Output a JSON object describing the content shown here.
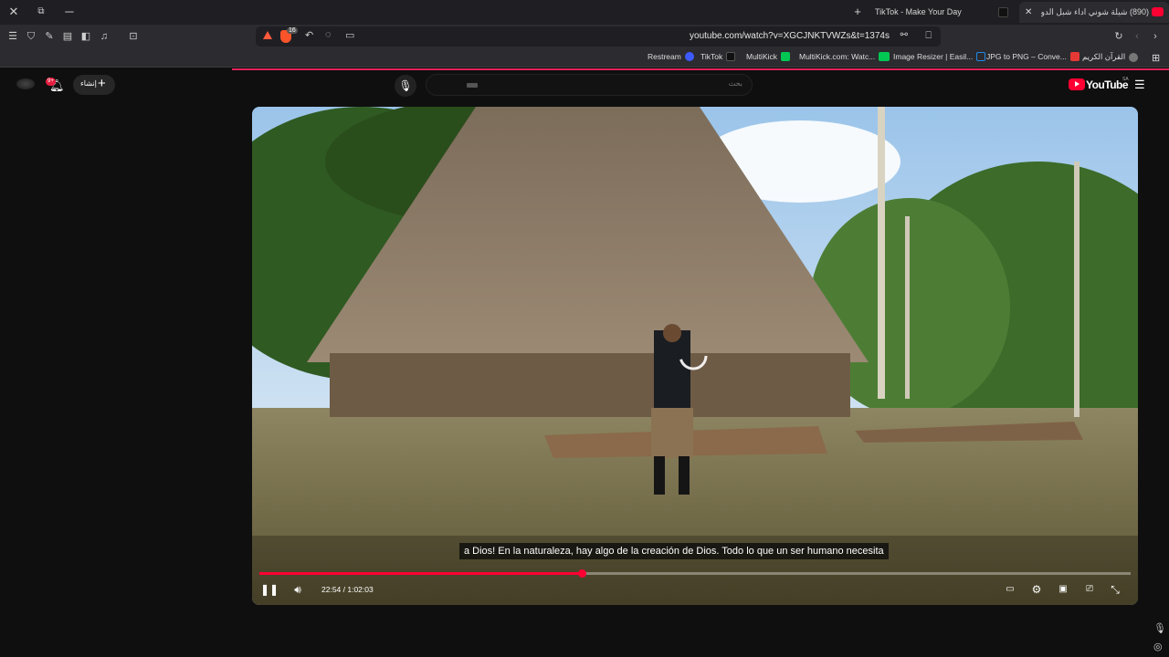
{
  "window": {
    "close": "✕",
    "restore": "⧉",
    "minimize": "─"
  },
  "tabs": [
    {
      "label": "TikTok - Make Your Day",
      "new_tab": "+"
    },
    {
      "label": "(890) شيلة شوني اداء شبل الدوا...",
      "close": "✕"
    }
  ],
  "toolbar": {
    "url": "youtube.com/watch?v=XGCJNKTVWZs&t=1374s",
    "shield_count": "16"
  },
  "bookmarks": [
    {
      "label": "Restream",
      "color": "#3d5afe"
    },
    {
      "label": "TikTok",
      "color": "#111111"
    },
    {
      "label": "MultiKick",
      "color": "#00c853"
    },
    {
      "label": "MultiKick.com: Watc...",
      "color": "#00c853"
    },
    {
      "label": "Image Resizer | Easil...",
      "color": "#1e88e5"
    },
    {
      "label": "JPG to PNG – Conve...",
      "color": "#e53935"
    },
    {
      "label": "القرآن الكريم",
      "color": "#777777"
    }
  ],
  "youtube": {
    "create_label": "إنشاء",
    "notif_count": "9+",
    "search_placeholder": "بحث",
    "logo_text": "YouTube",
    "region": "SA"
  },
  "player": {
    "subtitle": "a Dios! En la naturaleza, hay algo de la creación de Dios. Todo lo que un ser humano necesita",
    "time": "22:54 / 1:02:03",
    "progress": 0.37
  }
}
